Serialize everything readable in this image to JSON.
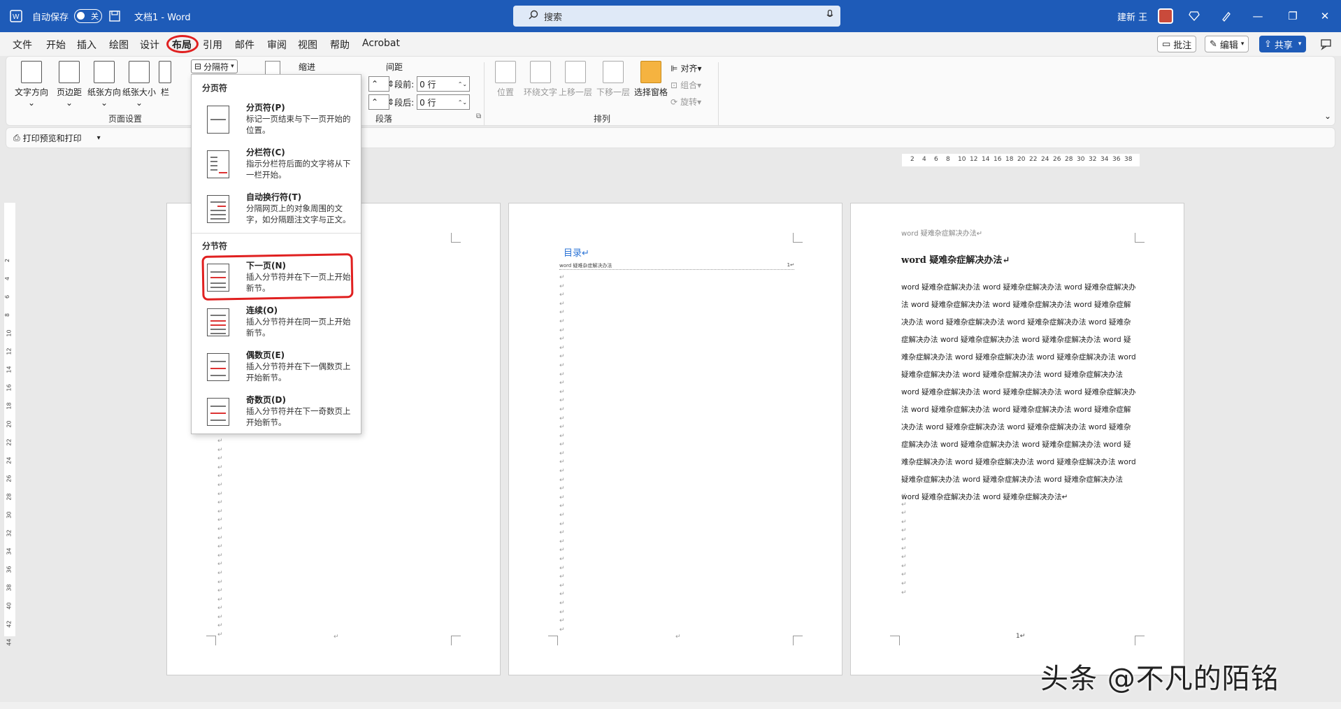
{
  "titlebar": {
    "autosave_label": "自动保存",
    "autosave_state": "关",
    "doc_title": "文档1 - Word",
    "search_placeholder": "搜索",
    "user_name": "建新 王"
  },
  "menu_tabs": [
    "文件",
    "开始",
    "插入",
    "绘图",
    "设计",
    "布局",
    "引用",
    "邮件",
    "审阅",
    "视图",
    "帮助",
    "Acrobat"
  ],
  "active_tab": "布局",
  "right_buttons": {
    "comment": "批注",
    "edit": "编辑",
    "share": "共享"
  },
  "ribbon": {
    "page_setup": {
      "items": [
        "文字方向",
        "页边距",
        "纸张方向",
        "纸张大小",
        "栏"
      ],
      "label": "页面设置"
    },
    "breaks_button": "分隔符",
    "indent_label": "缩进",
    "spacing_label": "间距",
    "spacing_before_label": "段前:",
    "spacing_before_value": "0 行",
    "spacing_after_label": "段后:",
    "spacing_after_value": "0 行",
    "paragraph_label": "段落",
    "arrange": {
      "items": [
        "位置",
        "环绕文字",
        "上移一层",
        "下移一层",
        "选择窗格"
      ],
      "align": "对齐",
      "group": "组合",
      "rotate": "旋转",
      "label": "排列"
    }
  },
  "qat": {
    "print_preview": "打印预览和打印"
  },
  "dropdown": {
    "page_breaks_header": "分页符",
    "section_breaks_header": "分节符",
    "page_break_items": [
      {
        "title": "分页符(P)",
        "desc": "标记一页结束与下一页开始的位置。"
      },
      {
        "title": "分栏符(C)",
        "desc": "指示分栏符后面的文字将从下一栏开始。"
      },
      {
        "title": "自动换行符(T)",
        "desc": "分隔网页上的对象周围的文字，如分隔题注文字与正文。"
      }
    ],
    "section_break_items": [
      {
        "title": "下一页(N)",
        "desc": "插入分节符并在下一页上开始新节。"
      },
      {
        "title": "连续(O)",
        "desc": "插入分节符并在同一页上开始新节。"
      },
      {
        "title": "偶数页(E)",
        "desc": "插入分节符并在下一偶数页上开始新节。"
      },
      {
        "title": "奇数页(D)",
        "desc": "插入分节符并在下一奇数页上开始新节。"
      }
    ]
  },
  "ruler": {
    "h_ticks": [
      "2",
      "4",
      "6",
      "8",
      "10",
      "12",
      "14",
      "16",
      "18",
      "20",
      "22",
      "24",
      "26",
      "28",
      "30",
      "32",
      "34",
      "36",
      "38"
    ],
    "v_ticks": [
      "2",
      "4",
      "6",
      "8",
      "10",
      "12",
      "14",
      "16",
      "18",
      "20",
      "22",
      "24",
      "26",
      "28",
      "30",
      "32",
      "34",
      "36",
      "38",
      "40",
      "42",
      "44"
    ]
  },
  "page2": {
    "toc_title": "目录↵",
    "toc_entry": "word 疑难杂症解决办法",
    "toc_page": "1↵"
  },
  "page3": {
    "header": "word 疑难杂症解决办法↵",
    "heading": "word 疑难杂症解决办法↵",
    "body": "word 疑难杂症解决办法 word 疑难杂症解决办法 word 疑难杂症解决办法 word 疑难杂症解决办法 word 疑难杂症解决办法 word 疑难杂症解决办法 word 疑难杂症解决办法 word 疑难杂症解决办法 word 疑难杂症解决办法 word 疑难杂症解决办法 word 疑难杂症解决办法 word 疑难杂症解决办法 word 疑难杂症解决办法 word 疑难杂症解决办法 word 疑难杂症解决办法 word 疑难杂症解决办法 word 疑难杂症解决办法 word 疑难杂症解决办法 word 疑难杂症解决办法 word 疑难杂症解决办法 word 疑难杂症解决办法 word 疑难杂症解决办法 word 疑难杂症解决办法 word 疑难杂症解决办法 word 疑难杂症解决办法 word 疑难杂症解决办法 word 疑难杂症解决办法 word 疑难杂症解决办法 word 疑难杂症解决办法 word 疑难杂症解决办法 word 疑难杂症解决办法 word 疑难杂症解决办法 word 疑难杂症解决办法 word 疑难杂症解决办法 word 疑难杂症解决办法 word 疑难杂症解决办法↵",
    "page_number": "1↵"
  },
  "watermark": "头条 @不凡的陌铭"
}
